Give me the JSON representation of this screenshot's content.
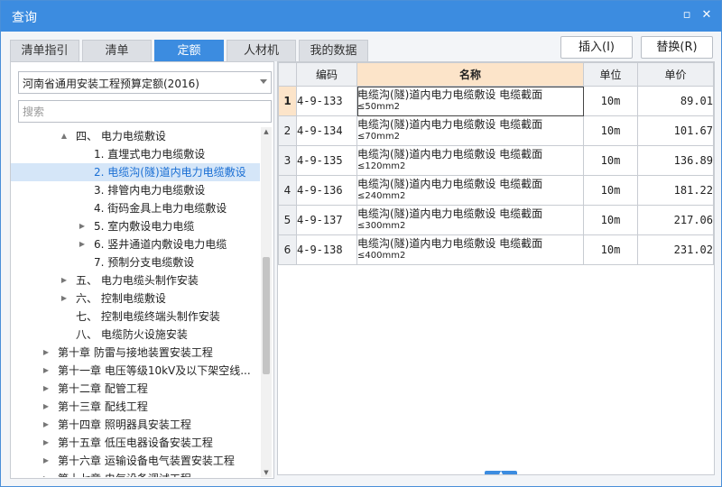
{
  "window": {
    "title": "查询",
    "restore_icon": "restore-icon",
    "close_icon": "close-icon"
  },
  "tabs": [
    {
      "label": "清单指引",
      "active": false
    },
    {
      "label": "清单",
      "active": false
    },
    {
      "label": "定额",
      "active": true
    },
    {
      "label": "人材机",
      "active": false
    },
    {
      "label": "我的数据",
      "active": false
    }
  ],
  "buttons": {
    "insert": "插入(I)",
    "replace": "替换(R)"
  },
  "left": {
    "library": "河南省通用安装工程预算定额(2016)",
    "search_placeholder": "搜索",
    "tree": [
      {
        "label": "四、 电力电缆敷设",
        "exp": "▲",
        "level": 2
      },
      {
        "label": "1. 直埋式电力电缆敷设",
        "exp": "",
        "level": 3
      },
      {
        "label": "2. 电缆沟(隧)道内电力电缆敷设",
        "exp": "",
        "level": 3,
        "selected": true
      },
      {
        "label": "3. 排管内电力电缆敷设",
        "exp": "",
        "level": 3
      },
      {
        "label": "4. 街码金具上电力电缆敷设",
        "exp": "",
        "level": 3
      },
      {
        "label": "5. 室内敷设电力电缆",
        "exp": "▶",
        "level": 3
      },
      {
        "label": "6. 竖井通道内敷设电力电缆",
        "exp": "▶",
        "level": 3
      },
      {
        "label": "7. 预制分支电缆敷设",
        "exp": "",
        "level": 3
      },
      {
        "label": "五、 电力电缆头制作安装",
        "exp": "▶",
        "level": 2
      },
      {
        "label": "六、 控制电缆敷设",
        "exp": "▶",
        "level": 2
      },
      {
        "label": "七、 控制电缆终端头制作安装",
        "exp": "",
        "level": 2
      },
      {
        "label": "八、 电缆防火设施安装",
        "exp": "",
        "level": 2
      },
      {
        "label": "第十章 防雷与接地装置安装工程",
        "exp": "▶",
        "level": 1
      },
      {
        "label": "第十一章 电压等级10kV及以下架空线...",
        "exp": "▶",
        "level": 1
      },
      {
        "label": "第十二章 配管工程",
        "exp": "▶",
        "level": 1
      },
      {
        "label": "第十三章 配线工程",
        "exp": "▶",
        "level": 1
      },
      {
        "label": "第十四章 照明器具安装工程",
        "exp": "▶",
        "level": 1
      },
      {
        "label": "第十五章 低压电器设备安装工程",
        "exp": "▶",
        "level": 1
      },
      {
        "label": "第十六章 运输设备电气装置安装工程",
        "exp": "▶",
        "level": 1
      },
      {
        "label": "第十七章 电气设备调试工程",
        "exp": "▶",
        "level": 1
      }
    ]
  },
  "table": {
    "headers": {
      "code": "编码",
      "name": "名称",
      "unit": "单位",
      "price": "单价"
    },
    "rows": [
      {
        "no": "1",
        "code": "4-9-133",
        "name": "电缆沟(隧)道内电力电缆敷设 电缆截面",
        "spec": "≤50mm2",
        "unit": "10m",
        "price": "89.01",
        "current": true
      },
      {
        "no": "2",
        "code": "4-9-134",
        "name": "电缆沟(隧)道内电力电缆敷设 电缆截面",
        "spec": "≤70mm2",
        "unit": "10m",
        "price": "101.67"
      },
      {
        "no": "3",
        "code": "4-9-135",
        "name": "电缆沟(隧)道内电力电缆敷设 电缆截面",
        "spec": "≤120mm2",
        "unit": "10m",
        "price": "136.89"
      },
      {
        "no": "4",
        "code": "4-9-136",
        "name": "电缆沟(隧)道内电力电缆敷设 电缆截面",
        "spec": "≤240mm2",
        "unit": "10m",
        "price": "181.22"
      },
      {
        "no": "5",
        "code": "4-9-137",
        "name": "电缆沟(隧)道内电力电缆敷设 电缆截面",
        "spec": "≤300mm2",
        "unit": "10m",
        "price": "217.06"
      },
      {
        "no": "6",
        "code": "4-9-138",
        "name": "电缆沟(隧)道内电力电缆敷设 电缆截面",
        "spec": "≤400mm2",
        "unit": "10m",
        "price": "231.02"
      }
    ]
  }
}
